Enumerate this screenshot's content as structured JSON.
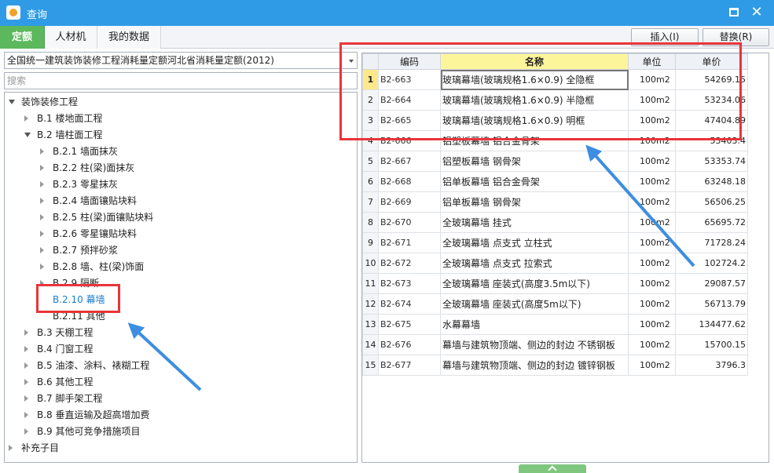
{
  "window": {
    "title": "查询"
  },
  "tabs": [
    {
      "label": "定额",
      "active": true
    },
    {
      "label": "人材机",
      "active": false
    },
    {
      "label": "我的数据",
      "active": false
    }
  ],
  "toolbar": {
    "insert_label": "插入(I)",
    "replace_label": "替换(R)"
  },
  "left_panel": {
    "library_select": "全国统一建筑装饰装修工程消耗量定额河北省消耗量定额(2012)",
    "search_placeholder": "搜索",
    "tree": [
      {
        "label": "装饰装修工程",
        "level": 0,
        "expanded": true
      },
      {
        "label": "B.1 楼地面工程",
        "level": 1,
        "expanded": false
      },
      {
        "label": "B.2 墙柱面工程",
        "level": 1,
        "expanded": true
      },
      {
        "label": "B.2.1 墙面抹灰",
        "level": 2,
        "expanded": false
      },
      {
        "label": "B.2.2 柱(梁)面抹灰",
        "level": 2,
        "expanded": false
      },
      {
        "label": "B.2.3 零星抹灰",
        "level": 2,
        "expanded": false
      },
      {
        "label": "B.2.4 墙面镶贴块料",
        "level": 2,
        "expanded": false
      },
      {
        "label": "B.2.5 柱(梁)面镶贴块料",
        "level": 2,
        "expanded": false
      },
      {
        "label": "B.2.6 零星镶贴块料",
        "level": 2,
        "expanded": false
      },
      {
        "label": "B.2.7 预拌砂浆",
        "level": 2,
        "expanded": false
      },
      {
        "label": "B.2.8 墙、柱(梁)饰面",
        "level": 2,
        "expanded": false
      },
      {
        "label": "B.2.9 隔断",
        "level": 2,
        "expanded": false
      },
      {
        "label": "B.2.10 幕墙",
        "level": 2,
        "expanded": null,
        "selected": true
      },
      {
        "label": "B.2.11 其他",
        "level": 2,
        "expanded": null
      },
      {
        "label": "B.3 天棚工程",
        "level": 1,
        "expanded": false
      },
      {
        "label": "B.4 门窗工程",
        "level": 1,
        "expanded": false
      },
      {
        "label": "B.5 油漆、涂料、裱糊工程",
        "level": 1,
        "expanded": false
      },
      {
        "label": "B.6 其他工程",
        "level": 1,
        "expanded": false
      },
      {
        "label": "B.7 脚手架工程",
        "level": 1,
        "expanded": false
      },
      {
        "label": "B.8 垂直运输及超高增加费",
        "level": 1,
        "expanded": false
      },
      {
        "label": "B.9 其他可竞争措施项目",
        "level": 1,
        "expanded": false
      },
      {
        "label": "补充子目",
        "level": 0,
        "expanded": false
      }
    ]
  },
  "grid": {
    "columns": [
      "",
      "编码",
      "名称",
      "单位",
      "单价"
    ],
    "rows": [
      {
        "no": "1",
        "code": "B2-663",
        "name": "玻璃幕墙(玻璃规格1.6×0.9) 全隐框",
        "unit": "100m2",
        "price": "54269.15"
      },
      {
        "no": "2",
        "code": "B2-664",
        "name": "玻璃幕墙(玻璃规格1.6×0.9) 半隐框",
        "unit": "100m2",
        "price": "53234.06"
      },
      {
        "no": "3",
        "code": "B2-665",
        "name": "玻璃幕墙(玻璃规格1.6×0.9) 明框",
        "unit": "100m2",
        "price": "47404.89"
      },
      {
        "no": "4",
        "code": "B2-666",
        "name": "铝塑板幕墙 铝合金骨架",
        "unit": "100m2",
        "price": "53403.4"
      },
      {
        "no": "5",
        "code": "B2-667",
        "name": "铝塑板幕墙 钢骨架",
        "unit": "100m2",
        "price": "53353.74"
      },
      {
        "no": "6",
        "code": "B2-668",
        "name": "铝单板幕墙 铝合金骨架",
        "unit": "100m2",
        "price": "63248.18"
      },
      {
        "no": "7",
        "code": "B2-669",
        "name": "铝单板幕墙 钢骨架",
        "unit": "100m2",
        "price": "56506.25"
      },
      {
        "no": "8",
        "code": "B2-670",
        "name": "全玻璃幕墙 挂式",
        "unit": "100m2",
        "price": "65695.72"
      },
      {
        "no": "9",
        "code": "B2-671",
        "name": "全玻璃幕墙 点支式 立柱式",
        "unit": "100m2",
        "price": "71728.24"
      },
      {
        "no": "10",
        "code": "B2-672",
        "name": "全玻璃幕墙 点支式 拉索式",
        "unit": "100m2",
        "price": "102724.2"
      },
      {
        "no": "11",
        "code": "B2-673",
        "name": "全玻璃幕墙 座装式(高度3.5m以下)",
        "unit": "100m2",
        "price": "29087.57"
      },
      {
        "no": "12",
        "code": "B2-674",
        "name": "全玻璃幕墙 座装式(高度5m以下)",
        "unit": "100m2",
        "price": "56713.79"
      },
      {
        "no": "13",
        "code": "B2-675",
        "name": "水幕幕墙",
        "unit": "100m2",
        "price": "134477.62"
      },
      {
        "no": "14",
        "code": "B2-676",
        "name": "幕墙与建筑物顶端、侧边的封边 不锈钢板",
        "unit": "100m2",
        "price": "15700.15"
      },
      {
        "no": "15",
        "code": "B2-677",
        "name": "幕墙与建筑物顶端、侧边的封边 镀锌钢板",
        "unit": "100m2",
        "price": "3796.3"
      }
    ],
    "current_row": 0
  },
  "colors": {
    "titlebar": "#2f9be6",
    "active_tab": "#5cb85c",
    "header_highlight": "#fdf59a",
    "annotation_red": "#e8353a",
    "annotation_arrow": "#3d8ee0",
    "selected_tree_text": "#1a7fd0"
  },
  "icons": {
    "app": "app-logo-icon",
    "maximize": "maximize-icon",
    "close": "close-icon",
    "dropdown": "chevron-down-icon",
    "expand_open": "triangle-down-icon",
    "expand_closed": "triangle-right-icon",
    "footer": "chevron-up-icon"
  }
}
